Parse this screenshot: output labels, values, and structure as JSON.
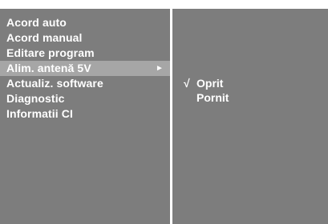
{
  "menu": {
    "items": [
      {
        "label": "Acord auto"
      },
      {
        "label": "Acord manual"
      },
      {
        "label": "Editare program"
      },
      {
        "label": "Alim. antenă 5V",
        "selected": true
      },
      {
        "label": "Actualiz. software"
      },
      {
        "label": "Diagnostic"
      },
      {
        "label": "Informatii CI"
      }
    ],
    "submenu_arrow": "►"
  },
  "submenu": {
    "options": [
      {
        "label": "Oprit",
        "checked": true,
        "check_glyph": "√"
      },
      {
        "label": "Pornit",
        "checked": false,
        "check_glyph": ""
      }
    ]
  },
  "colors": {
    "panel_bg": "#7d7d7d",
    "highlight_bg": "#a6a6a6",
    "text": "#ffffff"
  },
  "icons": {
    "submenu_arrow": "arrow-right-icon",
    "check": "checkmark-icon"
  }
}
